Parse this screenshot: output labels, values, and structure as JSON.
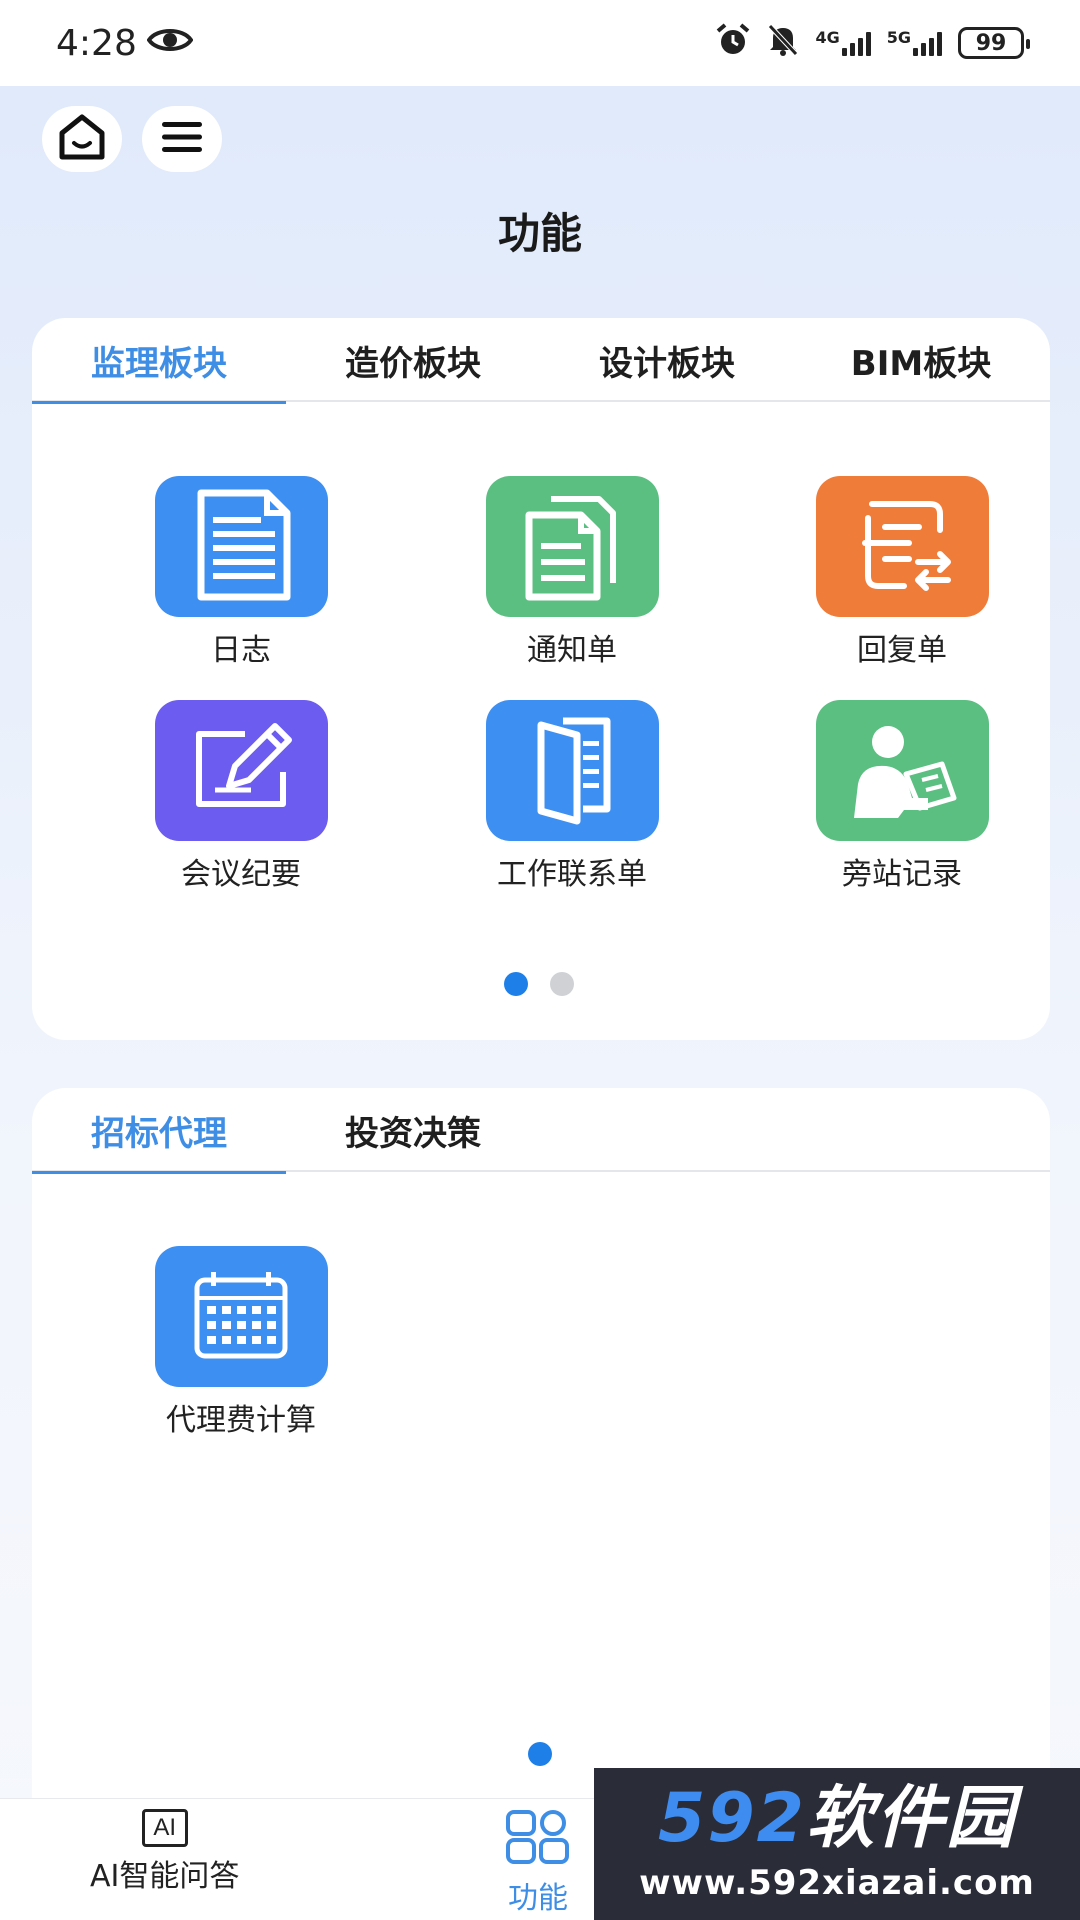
{
  "status_bar": {
    "time": "4:28",
    "battery": "99",
    "net1": "4G",
    "net2": "5G"
  },
  "header": {
    "title": "功能"
  },
  "section1": {
    "tabs": [
      {
        "label": "监理板块",
        "active": true
      },
      {
        "label": "造价板块",
        "active": false
      },
      {
        "label": "设计板块",
        "active": false
      },
      {
        "label": "BIM板块",
        "active": false
      }
    ],
    "items": [
      {
        "label": "日志",
        "icon": "document-icon",
        "color": "#3e8ff2"
      },
      {
        "label": "通知单",
        "icon": "copy-documents-icon",
        "color": "#5cbf82"
      },
      {
        "label": "回复单",
        "icon": "reply-list-icon",
        "color": "#f07c3a"
      },
      {
        "label": "会议纪要",
        "icon": "edit-pencil-icon",
        "color": "#6c5cf0"
      },
      {
        "label": "工作联系单",
        "icon": "folder-sheet-icon",
        "color": "#3e8ff2"
      },
      {
        "label": "旁站记录",
        "icon": "person-writing-icon",
        "color": "#5cbf82"
      }
    ],
    "pages": 2,
    "current_page": 1
  },
  "section2": {
    "tabs": [
      {
        "label": "招标代理",
        "active": true
      },
      {
        "label": "投资决策",
        "active": false
      }
    ],
    "items": [
      {
        "label": "代理费计算",
        "icon": "calendar-calculator-icon",
        "color": "#3e8ff2"
      }
    ],
    "pages": 1,
    "current_page": 1
  },
  "bottom_nav": {
    "items": [
      {
        "label": "AI智能问答",
        "icon": "ai-icon",
        "active": false
      },
      {
        "label": "功能",
        "icon": "grid-icon",
        "active": true
      }
    ],
    "ai_icon_text": "AI"
  },
  "watermark": {
    "brand_num": "592",
    "brand_cn": "软件园",
    "url": "www.592xiazai.com"
  },
  "colors": {
    "accent": "#3f8ee6",
    "active_dot": "#1f7fe9"
  }
}
